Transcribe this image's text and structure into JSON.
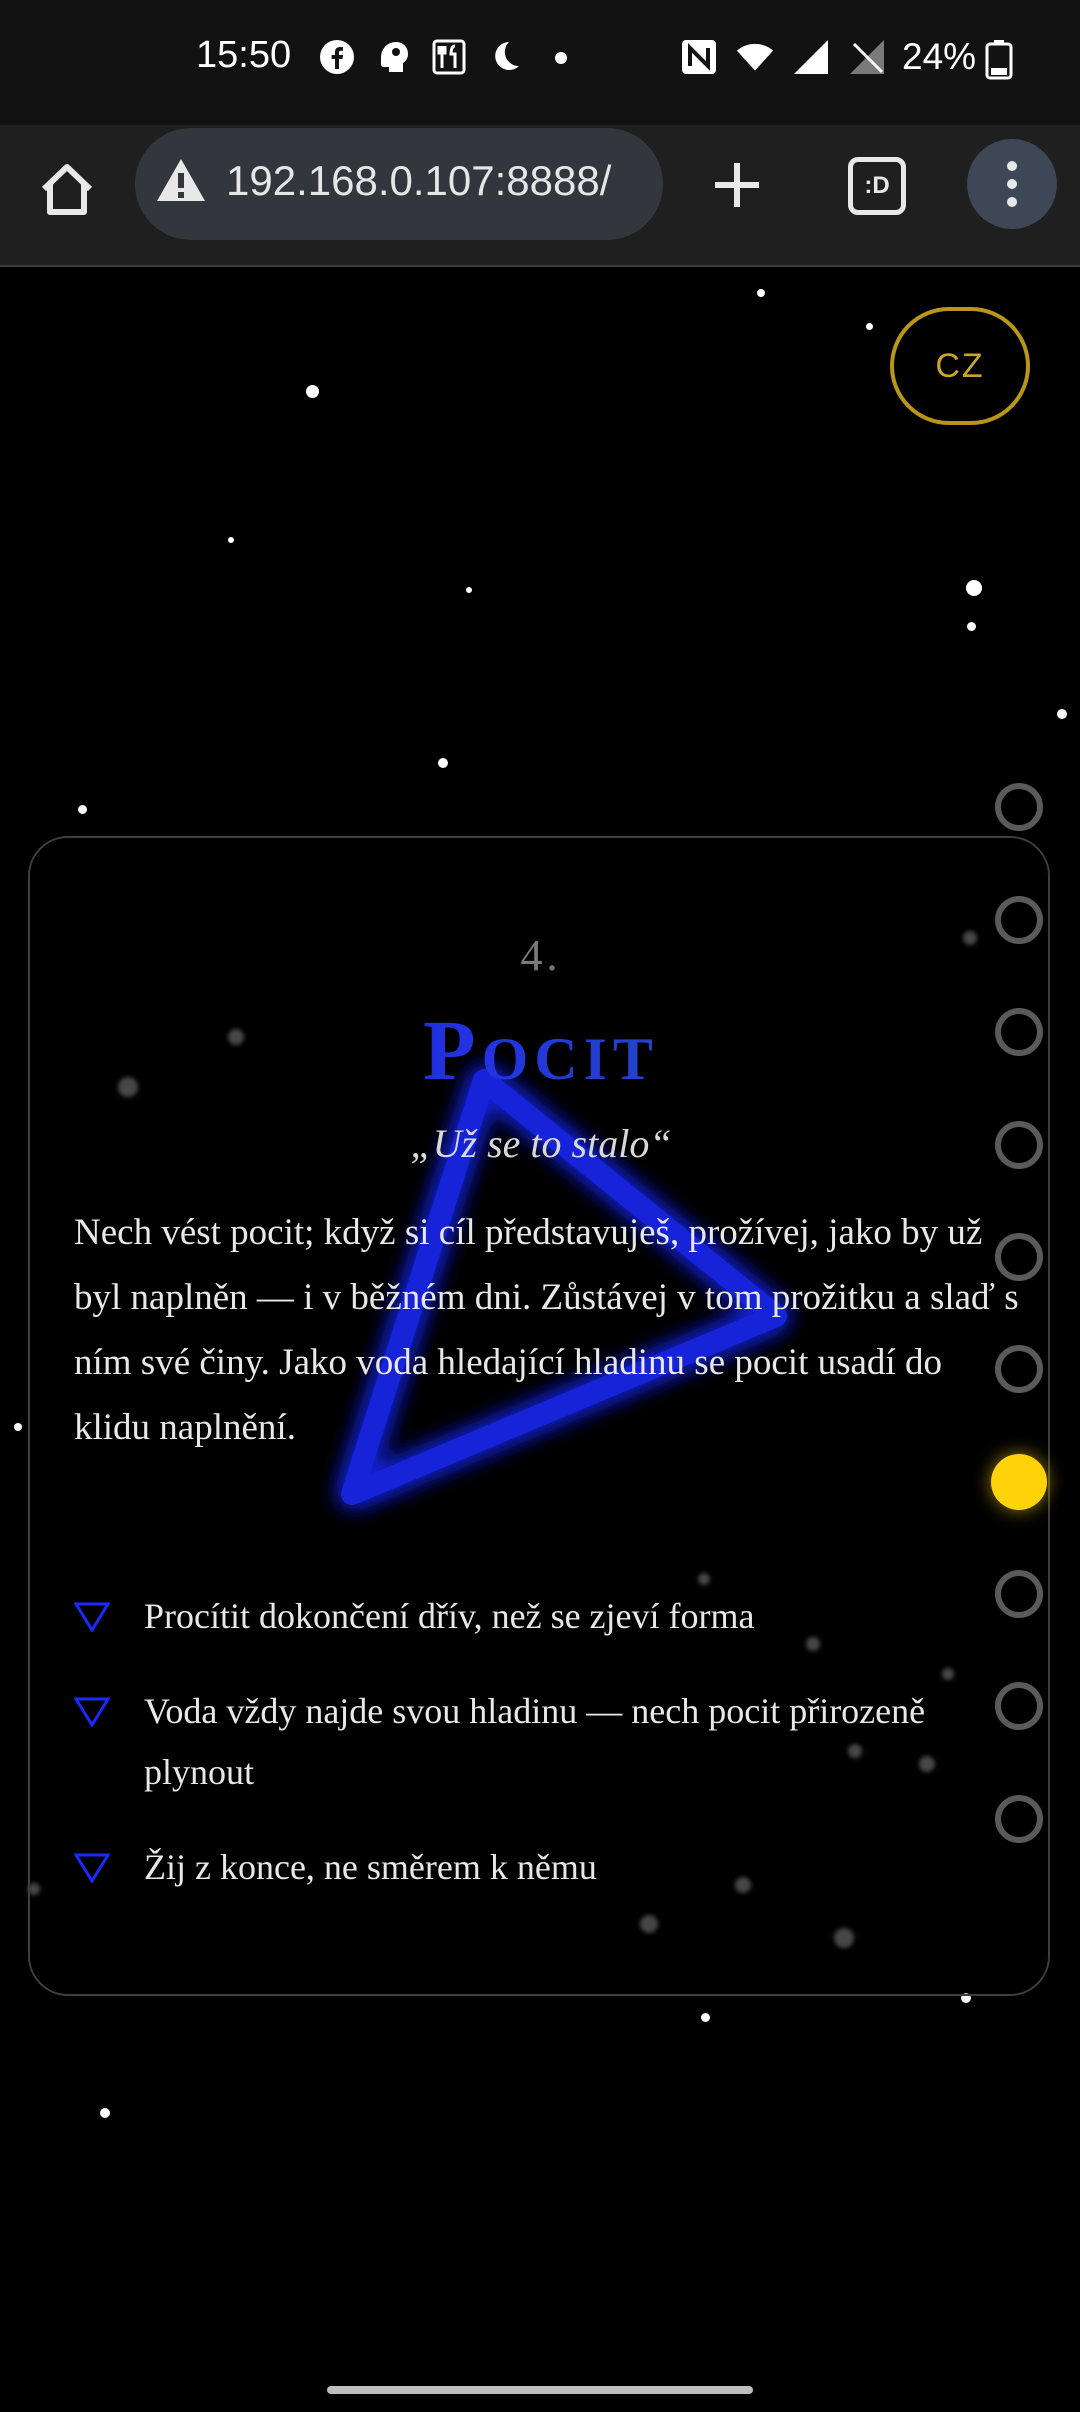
{
  "status_bar": {
    "time": "15:50",
    "left_icons": [
      "facebook-icon",
      "assistant-icon",
      "restaurant-icon",
      "night-icon",
      "dot-icon"
    ],
    "right_icons": [
      "nfc-icon",
      "wifi-icon",
      "signal-icon",
      "no-signal-icon"
    ],
    "battery_percent": "24%"
  },
  "browser": {
    "url": "192.168.0.107:8888/",
    "tabs_label": ":D"
  },
  "page": {
    "language_button": "CZ",
    "card": {
      "number": "4.",
      "title": "Pocit",
      "subtitle": "„Už se to stalo“",
      "body": "Nech vést pocit; když si cíl představuješ, prožívej, jako by už byl naplněn — i v běžném dni. Zůstávej v tom prožitku a slaď s ním své činy. Jako voda hledající hladinu se pocit usadí do klidu naplnění.",
      "bullets": [
        "Procítit dokončení dřív, než se zjeví forma",
        "Voda vždy najde svou hladinu — nech pocit přirozeně plynout",
        "Žij z konce, ne směrem k němu"
      ]
    },
    "section_nav": {
      "total": 10,
      "active_index": 6
    },
    "accent_colors": {
      "gold": "#ffd20a",
      "title_blue": "#2233e0",
      "triangle_blue": "#1a2aff"
    }
  }
}
